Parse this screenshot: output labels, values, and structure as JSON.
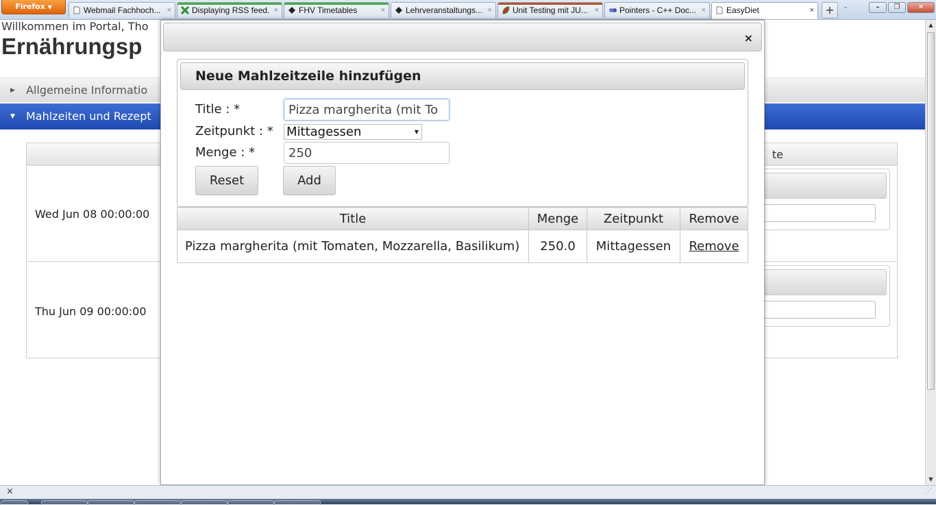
{
  "browser": {
    "menu_button_label": "Firefox",
    "tabs": [
      {
        "label": "Webmail Fachhoch...",
        "icon": "page-icon"
      },
      {
        "label": "Displaying RSS feed...",
        "icon": "green-x-icon"
      },
      {
        "label": "FHV Timetables",
        "icon": "fhv-icon"
      },
      {
        "label": "Lehrveranstaltungs...",
        "icon": "fhv-icon"
      },
      {
        "label": "Unit Testing mit JU...",
        "icon": "red-leaf-icon"
      },
      {
        "label": "Pointers - C++ Doc...",
        "icon": "cpp-icon"
      },
      {
        "label": "EasyDiet",
        "icon": "page-icon"
      }
    ],
    "active_tab_index": 6,
    "tab_close_glyph": "×",
    "new_tab_glyph": "+",
    "status_close_glyph": "×"
  },
  "page": {
    "welcome_text": "Willkommen im Portal, Tho",
    "title": "Ernährungsp",
    "accordion": [
      {
        "label": "Allgemeine Informatio",
        "expanded": false
      },
      {
        "label": "Mahlzeiten und Rezept",
        "expanded": true
      }
    ],
    "panel_header_right": "te",
    "rows": [
      {
        "date": "Wed Jun 08 00:00:00"
      },
      {
        "date": "Thu Jun 09 00:00:00"
      }
    ]
  },
  "modal": {
    "close_glyph": "×",
    "form": {
      "header": "Neue Mahlzeitzeile hinzufügen",
      "title_label": "Title : *",
      "title_value": "Pizza margherita (mit To",
      "zeitpunkt_label": "Zeitpunkt : *",
      "zeitpunkt_value": "Mittagessen",
      "menge_label": "Menge : *",
      "menge_value": "250",
      "reset_label": "Reset",
      "add_label": "Add"
    },
    "table": {
      "headers": [
        "Title",
        "Menge",
        "Zeitpunkt",
        "Remove"
      ],
      "rows": [
        {
          "title": "Pizza margherita (mit Tomaten, Mozzarella, Basilikum)",
          "menge": "250.0",
          "zeitpunkt": "Mittagessen",
          "remove": "Remove"
        }
      ]
    }
  },
  "colors": {
    "accent": "#2a56c0",
    "firefox_button": "#e8720f"
  }
}
